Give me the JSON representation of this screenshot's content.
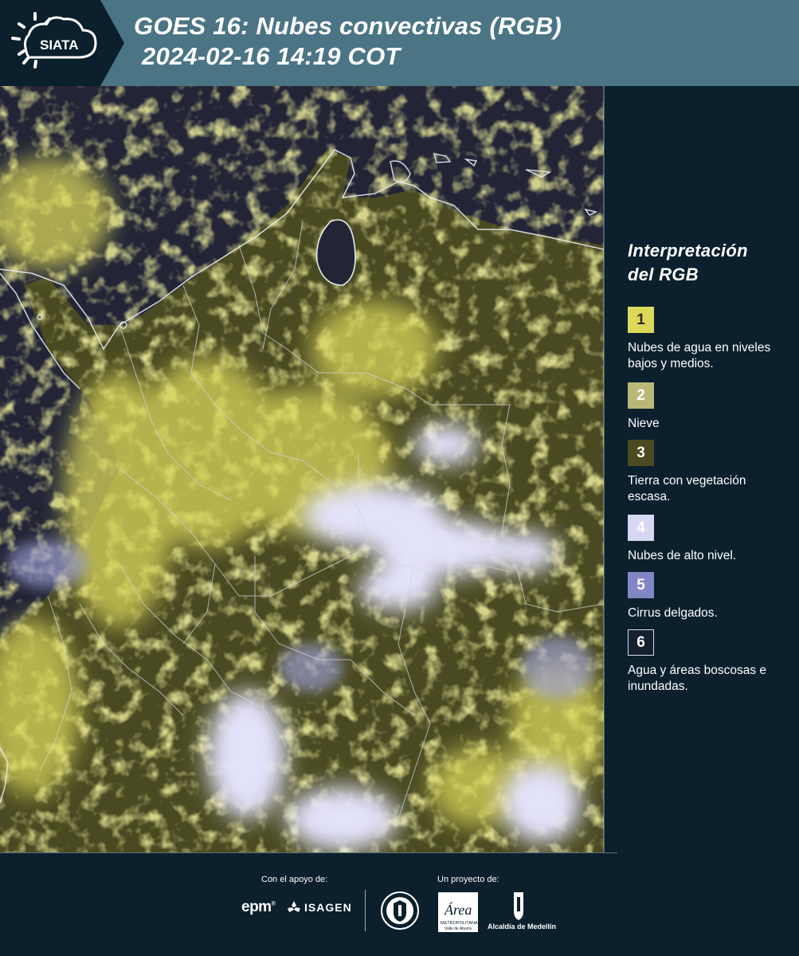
{
  "header": {
    "logo_text": "SIATA",
    "title_line1": "GOES 16: Nubes convectivas (RGB)",
    "title_line2": "2024-02-16 14:19 COT",
    "background_color": "#4b7585"
  },
  "map": {
    "background_color": "#232536",
    "border_color": "#d8dde0"
  },
  "legend": {
    "title_line1": "Interpretación",
    "title_line2": "del RGB",
    "items": [
      {
        "number": "1",
        "label": "Nubes de agua en niveles bajos y medios.",
        "color": "#dcd95a",
        "text_color": "#2b2b10"
      },
      {
        "number": "2",
        "label": "Nieve",
        "color": "#b9b876",
        "text_color": "#ffffff"
      },
      {
        "number": "3",
        "label": "Tierra con vegetación escasa.",
        "color": "#4b4a20",
        "text_color": "#ffffff"
      },
      {
        "number": "4",
        "label": "Nubes de alto nivel.",
        "color": "#d7d7f4",
        "text_color": "#ffffff"
      },
      {
        "number": "5",
        "label": "Cirrus delgados.",
        "color": "#8386c5",
        "text_color": "#ffffff"
      },
      {
        "number": "6",
        "label": "Agua y áreas boscosas e inundadas.",
        "color": "#17202f",
        "text_color": "#ffffff"
      }
    ]
  },
  "footer": {
    "support_label": "Con el apoyo de:",
    "project_label": "Un proyecto de:",
    "epm_text": "epm",
    "isagen_text": "ISAGEN",
    "area_text": "Área",
    "area_subtext1": "METROPOLITANA",
    "area_subtext2": "Valle de Aburrá",
    "alcaldia_text": "Alcaldía de Medellín"
  }
}
